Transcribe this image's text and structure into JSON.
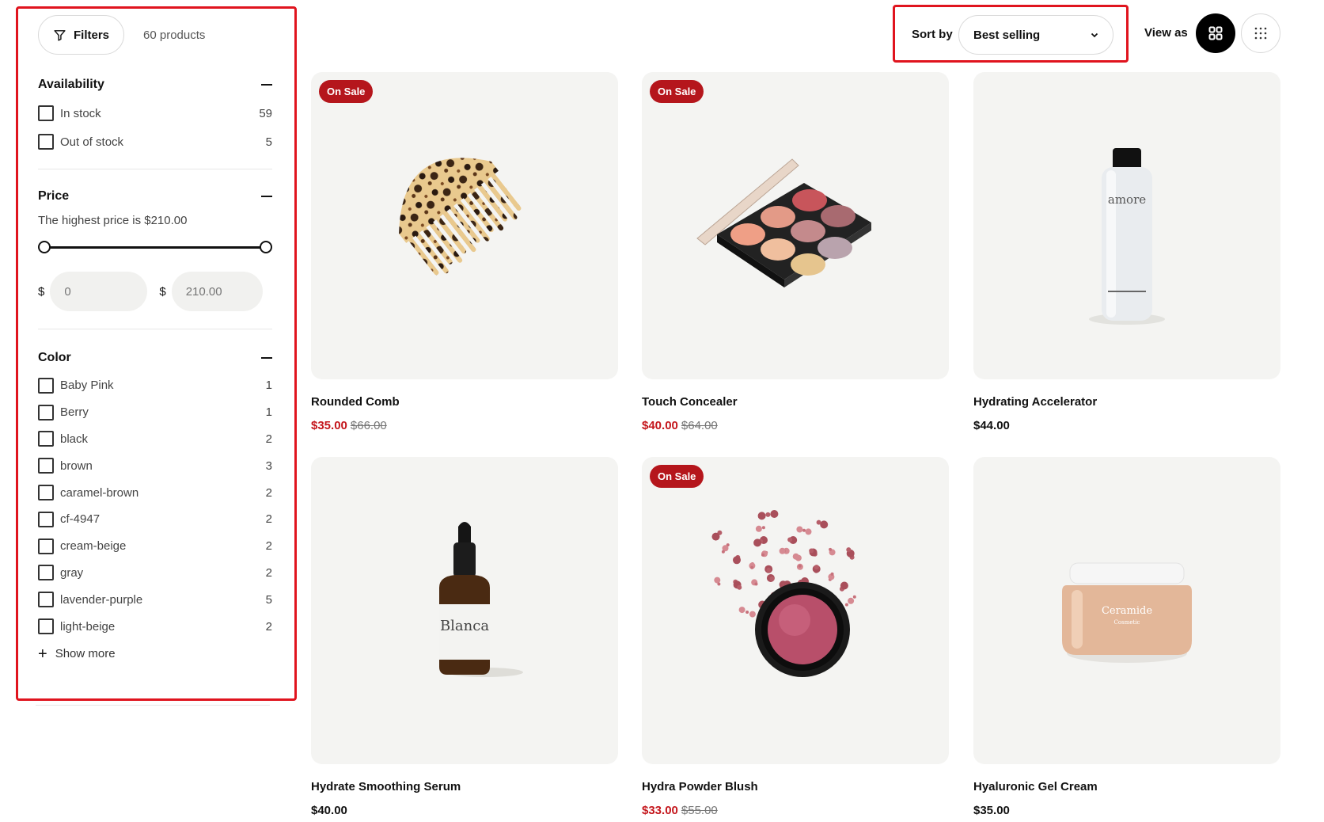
{
  "filters": {
    "button_label": "Filters",
    "product_count": "60 products",
    "availability": {
      "title": "Availability",
      "options": [
        {
          "label": "In stock",
          "count": "59"
        },
        {
          "label": "Out of stock",
          "count": "5"
        }
      ]
    },
    "price": {
      "title": "Price",
      "note": "The highest price is $210.00",
      "currency": "$",
      "min_placeholder": "0",
      "max_placeholder": "210.00",
      "range_min_fraction": 0,
      "range_max_fraction": 1
    },
    "color": {
      "title": "Color",
      "options": [
        {
          "label": "Baby Pink",
          "count": "1"
        },
        {
          "label": "Berry",
          "count": "1"
        },
        {
          "label": "black",
          "count": "2"
        },
        {
          "label": "brown",
          "count": "3"
        },
        {
          "label": "caramel-brown",
          "count": "2"
        },
        {
          "label": "cf-4947",
          "count": "2"
        },
        {
          "label": "cream-beige",
          "count": "2"
        },
        {
          "label": "gray",
          "count": "2"
        },
        {
          "label": "lavender-purple",
          "count": "5"
        },
        {
          "label": "light-beige",
          "count": "2"
        }
      ],
      "show_more": "Show more"
    }
  },
  "sort": {
    "label": "Sort by",
    "selected": "Best selling"
  },
  "view": {
    "label": "View as",
    "active": "grid-large"
  },
  "products": [
    {
      "name": "Rounded Comb",
      "badge": "On Sale",
      "price": "$35.00",
      "old_price": "$66.00",
      "image": "comb"
    },
    {
      "name": "Touch Concealer",
      "badge": "On Sale",
      "price": "$40.00",
      "old_price": "$64.00",
      "image": "palette"
    },
    {
      "name": "Hydrating Accelerator",
      "badge": "",
      "price": "$44.00",
      "old_price": "",
      "image": "bottle",
      "image_text": "amore"
    },
    {
      "name": "Hydrate Smoothing Serum",
      "badge": "",
      "price": "$40.00",
      "old_price": "",
      "image": "dropper",
      "image_text": "Blanca"
    },
    {
      "name": "Hydra Powder Blush",
      "badge": "On Sale",
      "price": "$33.00",
      "old_price": "$55.00",
      "image": "blush"
    },
    {
      "name": "Hyaluronic Gel Cream",
      "badge": "",
      "price": "$35.00",
      "old_price": "",
      "image": "jar",
      "image_text": "Ceramide",
      "image_subtext": "Cosmetic"
    }
  ],
  "colors": {
    "highlight_border": "#e0141e",
    "sale_badge": "#b5161c",
    "sale_price": "#c4161c",
    "card_bg": "#f4f4f2"
  }
}
